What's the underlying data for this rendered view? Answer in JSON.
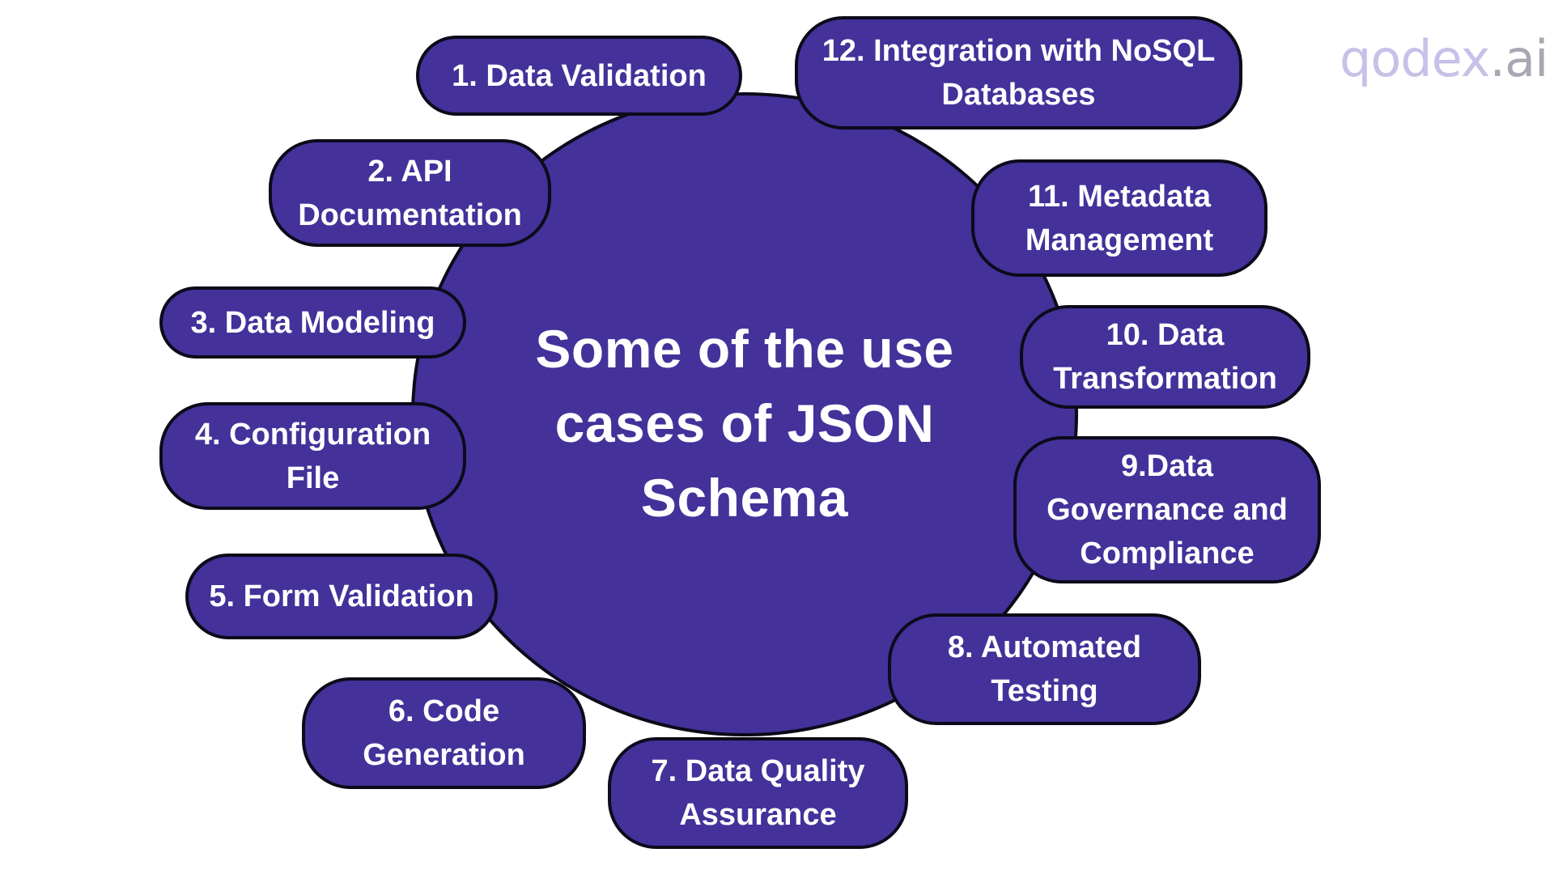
{
  "title": {
    "lines": [
      "Some of the use",
      "cases of JSON",
      "Schema"
    ]
  },
  "logo": {
    "brand": "qodex",
    "suffix": ".ai"
  },
  "use_cases": [
    {
      "lines": [
        "1. Data Validation"
      ]
    },
    {
      "lines": [
        "2. API",
        "Documentation"
      ]
    },
    {
      "lines": [
        "3. Data Modeling"
      ]
    },
    {
      "lines": [
        "4. Configuration",
        "File"
      ]
    },
    {
      "lines": [
        "5. Form Validation"
      ]
    },
    {
      "lines": [
        "6. Code",
        "Generation"
      ]
    },
    {
      "lines": [
        "7. Data Quality",
        "Assurance"
      ]
    },
    {
      "lines": [
        "8. Automated",
        "Testing"
      ]
    },
    {
      "lines": [
        "9.Data",
        "Governance and",
        "Compliance"
      ]
    },
    {
      "lines": [
        "10. Data",
        "Transformation"
      ]
    },
    {
      "lines": [
        "11. Metadata",
        "Management"
      ]
    },
    {
      "lines": [
        "12. Integration with NoSQL",
        "Databases"
      ]
    }
  ],
  "colors": {
    "fill": "#44319a",
    "outline": "#0d0a1a",
    "text": "#ffffff",
    "logo_primary": "#c9c0e8",
    "logo_secondary": "#a9a7b3"
  }
}
